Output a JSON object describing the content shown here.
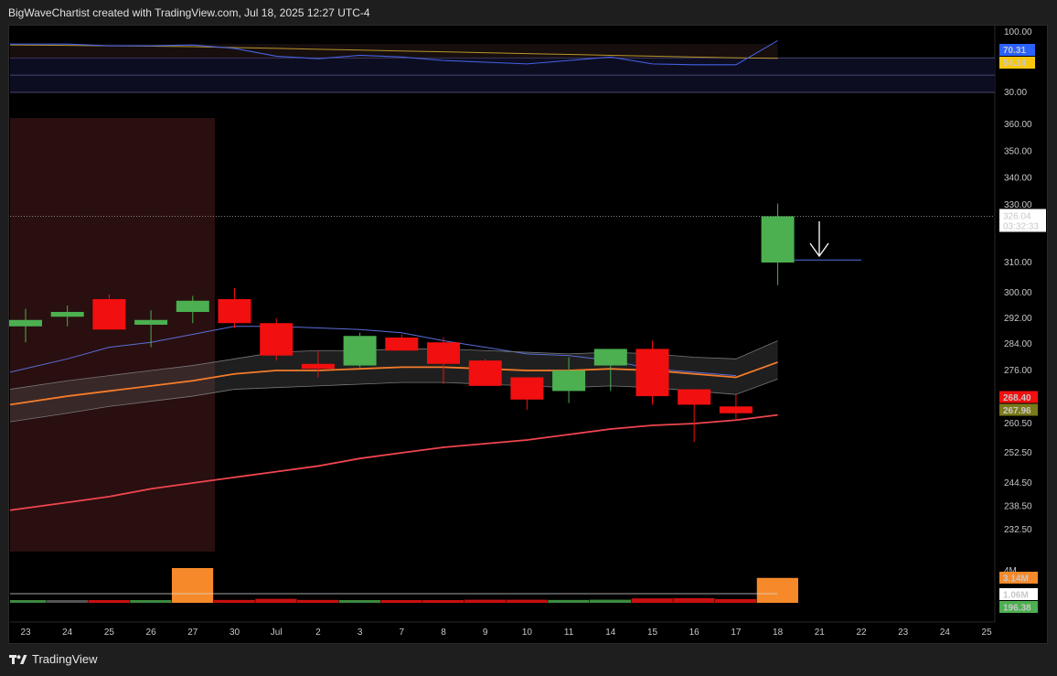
{
  "header": {
    "text": "BigWaveChartist created with TradingView.com, Jul 18, 2025 12:27 UTC-4"
  },
  "footer": {
    "brand": "TradingView"
  },
  "colors": {
    "up": "#4caf50",
    "down": "#f20f0f",
    "ema_short": "#5b6ed8",
    "ema_mid": "#f57c2b",
    "ema_long": "#f0454f",
    "rsi": "#4360e0",
    "rsi_ma": "#b8952a",
    "volume_highlight": "#f68a2a",
    "shade": "#3a1515"
  },
  "chart_data": [
    {
      "type": "candlestick",
      "x_labels": [
        "23",
        "24",
        "25",
        "26",
        "27",
        "30",
        "Jul",
        "2",
        "3",
        "7",
        "8",
        "9",
        "10",
        "11",
        "14",
        "15",
        "16",
        "17",
        "18",
        "21",
        "22",
        "23",
        "24",
        "25"
      ],
      "candles": [
        {
          "date": "23",
          "open": 289.5,
          "high": 295,
          "low": 284.5,
          "close": 291.5
        },
        {
          "date": "24",
          "open": 292.5,
          "high": 296,
          "low": 289.5,
          "close": 294
        },
        {
          "date": "25",
          "open": 298,
          "high": 299.5,
          "low": 288.5,
          "close": 288.5
        },
        {
          "date": "26",
          "open": 290,
          "high": 294.5,
          "low": 283,
          "close": 291.5
        },
        {
          "date": "27",
          "open": 294,
          "high": 299,
          "low": 290.5,
          "close": 297.5
        },
        {
          "date": "30",
          "open": 298,
          "high": 301.5,
          "low": 289,
          "close": 290.5
        },
        {
          "date": "Jul",
          "open": 290.5,
          "high": 292,
          "low": 279,
          "close": 280.5
        },
        {
          "date": "2",
          "open": 278,
          "high": 282,
          "low": 274,
          "close": 276.5
        },
        {
          "date": "3",
          "open": 277.5,
          "high": 287.5,
          "low": 277,
          "close": 286.5
        },
        {
          "date": "7",
          "open": 286,
          "high": 287,
          "low": 282,
          "close": 282
        },
        {
          "date": "8",
          "open": 284.5,
          "high": 286,
          "low": 272,
          "close": 278
        },
        {
          "date": "9",
          "open": 279,
          "high": 279.5,
          "low": 271.5,
          "close": 271.5
        },
        {
          "date": "10",
          "open": 274,
          "high": 274,
          "low": 264.5,
          "close": 267.5
        },
        {
          "date": "11",
          "open": 270,
          "high": 280,
          "low": 266.5,
          "close": 276
        },
        {
          "date": "14",
          "open": 277.5,
          "high": 282.5,
          "low": 270,
          "close": 282.5
        },
        {
          "date": "15",
          "open": 282.5,
          "high": 285,
          "low": 266,
          "close": 268.5
        },
        {
          "date": "16",
          "open": 270.5,
          "high": 270.5,
          "low": 255.5,
          "close": 266
        },
        {
          "date": "17",
          "open": 265.5,
          "high": 269,
          "low": 261.5,
          "close": 263.5
        },
        {
          "date": "18",
          "open": 310,
          "high": 330.5,
          "low": 302.5,
          "close": 326.04
        }
      ],
      "overlays": [
        {
          "name": "ema_short",
          "values": [
            275.5,
            279.5,
            283,
            284.5,
            287,
            289.5,
            289.5,
            289,
            288.5,
            287.5,
            285,
            283,
            281,
            280.5,
            279,
            276.5,
            275.5,
            274.5,
            null
          ]
        },
        {
          "name": "ema_mid",
          "values": [
            266,
            268.5,
            270,
            271.5,
            273,
            275,
            276,
            276,
            276.5,
            277,
            277,
            276.5,
            276,
            276,
            276.5,
            276,
            275,
            274,
            278.5
          ]
        },
        {
          "name": "ema_mid_upper",
          "values": [
            270.5,
            273,
            274.5,
            276,
            277.5,
            279.5,
            281.5,
            282,
            282,
            282.5,
            282.5,
            282,
            281.5,
            281,
            281.5,
            281,
            280,
            279.5,
            285
          ]
        },
        {
          "name": "ema_mid_lower",
          "values": [
            261,
            263.5,
            265.5,
            267,
            268.5,
            270.5,
            271,
            271.5,
            272,
            272.5,
            272.5,
            272,
            271.5,
            271,
            271.5,
            271,
            270,
            269,
            273.5
          ]
        },
        {
          "name": "ema_long",
          "values": [
            237.5,
            239.5,
            241,
            243,
            244.5,
            246,
            247.5,
            249,
            251,
            252.5,
            254,
            255,
            256,
            257.5,
            259,
            260,
            260.5,
            261.5,
            263
          ]
        }
      ],
      "price_ticks": [
        360,
        350,
        340,
        330,
        310,
        300,
        292,
        284,
        276,
        260.5,
        252.5,
        244.5,
        238.5,
        232.5
      ],
      "last_price": {
        "value": "326.04",
        "countdown": "03:32:33"
      },
      "price_badges": [
        {
          "value": "268.40",
          "color": "#f20f0f",
          "price": 268.4
        },
        {
          "value": "267.96",
          "color": "#7a7a1a",
          "price": 267.96
        }
      ],
      "arrow_annotation": {
        "price": 311.5
      }
    },
    {
      "type": "line",
      "name": "RSI panel",
      "ylim": [
        30,
        100
      ],
      "ticks": [
        "100.00",
        "30.00"
      ],
      "rsi": [
        86,
        86,
        84,
        84,
        85,
        81,
        72,
        69,
        73,
        71,
        67,
        65,
        63,
        67,
        71,
        63,
        62,
        62,
        90
      ],
      "rsi_ma": [
        85,
        84.5,
        84,
        83.5,
        83,
        82,
        81,
        80,
        79,
        78,
        77,
        76,
        75,
        74,
        73,
        72,
        71,
        70,
        69.5
      ],
      "levels": [
        70,
        50,
        30
      ],
      "badges": [
        {
          "value": "70.31",
          "color": "#2962ff"
        },
        {
          "value": "54.14",
          "color": "#f9c80e"
        }
      ]
    },
    {
      "type": "bar",
      "name": "Volume",
      "tick_label": "4M",
      "values": [
        0.22,
        0.22,
        0.24,
        0.22,
        3.14,
        0.26,
        0.36,
        0.26,
        0.22,
        0.2,
        0.18,
        0.28,
        0.28,
        0.26,
        0.28,
        0.4,
        0.42,
        0.34,
        2.25
      ],
      "colors_idx": [
        "up",
        "neutral",
        "down",
        "up",
        "highlight",
        "down",
        "down",
        "down",
        "up",
        "down",
        "down",
        "down",
        "down",
        "up",
        "up",
        "down",
        "down",
        "down",
        "highlight"
      ],
      "badges": [
        {
          "value": "3.14M",
          "color": "#f68a2a"
        },
        {
          "value": "1.06M",
          "color": "#ffffff"
        },
        {
          "value": "196.38",
          "color": "#4caf50"
        }
      ]
    }
  ]
}
